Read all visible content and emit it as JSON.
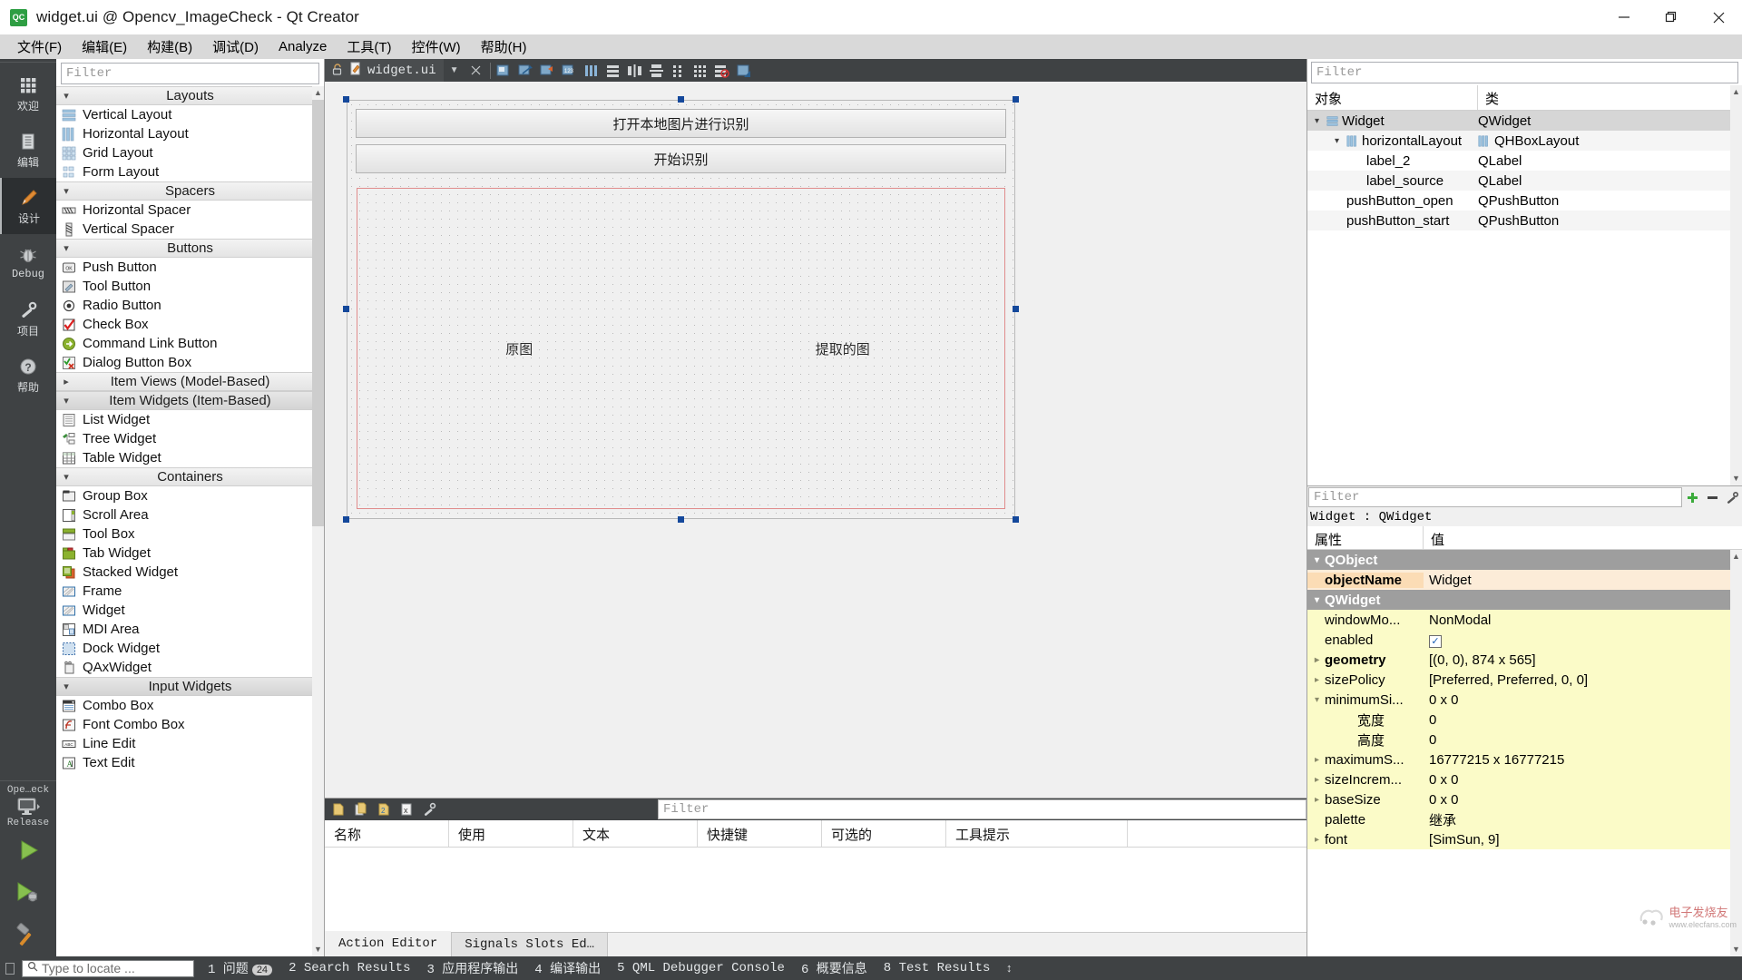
{
  "window": {
    "title": "widget.ui @ Opencv_ImageCheck - Qt Creator",
    "app_badge": "QC",
    "controls": {
      "minimize": "minimize-icon",
      "restore": "restore-icon",
      "close": "close-icon"
    }
  },
  "menubar": [
    "文件(F)",
    "编辑(E)",
    "构建(B)",
    "调试(D)",
    "Analyze",
    "工具(T)",
    "控件(W)",
    "帮助(H)"
  ],
  "modebar": {
    "items": [
      {
        "label": "欢迎",
        "icon": "grid-icon",
        "active": false
      },
      {
        "label": "编辑",
        "icon": "document-icon",
        "active": false
      },
      {
        "label": "设计",
        "icon": "pencil-icon",
        "active": true
      },
      {
        "label": "Debug",
        "icon": "bug-icon",
        "active": false
      },
      {
        "label": "项目",
        "icon": "wrench-icon",
        "active": false
      },
      {
        "label": "帮助",
        "icon": "question-icon",
        "active": false
      }
    ],
    "kit": {
      "project": "Ope…eck",
      "build": "Release",
      "icon": "monitor-icon"
    },
    "run_icon": "run-triangle-icon",
    "debug_icon": "debug-triangle-icon",
    "build_icon": "hammer-icon"
  },
  "widgetbox": {
    "filter_placeholder": "Filter",
    "groups": [
      {
        "title": "Layouts",
        "expanded": true,
        "selected": false,
        "items": [
          {
            "label": "Vertical Layout",
            "icon": "vertical-layout-icon"
          },
          {
            "label": "Horizontal Layout",
            "icon": "horizontal-layout-icon"
          },
          {
            "label": "Grid Layout",
            "icon": "grid-layout-icon"
          },
          {
            "label": "Form Layout",
            "icon": "form-layout-icon"
          }
        ]
      },
      {
        "title": "Spacers",
        "expanded": true,
        "selected": false,
        "items": [
          {
            "label": "Horizontal Spacer",
            "icon": "horizontal-spacer-icon"
          },
          {
            "label": "Vertical Spacer",
            "icon": "vertical-spacer-icon"
          }
        ]
      },
      {
        "title": "Buttons",
        "expanded": true,
        "selected": false,
        "items": [
          {
            "label": "Push Button",
            "icon": "push-button-icon"
          },
          {
            "label": "Tool Button",
            "icon": "tool-button-icon"
          },
          {
            "label": "Radio Button",
            "icon": "radio-button-icon"
          },
          {
            "label": "Check Box",
            "icon": "check-box-icon"
          },
          {
            "label": "Command Link Button",
            "icon": "command-link-icon"
          },
          {
            "label": "Dialog Button Box",
            "icon": "dialog-button-box-icon"
          }
        ]
      },
      {
        "title": "Item Views (Model-Based)",
        "expanded": false,
        "selected": false,
        "items": []
      },
      {
        "title": "Item Widgets (Item-Based)",
        "expanded": true,
        "selected": true,
        "items": [
          {
            "label": "List Widget",
            "icon": "list-widget-icon"
          },
          {
            "label": "Tree Widget",
            "icon": "tree-widget-icon"
          },
          {
            "label": "Table Widget",
            "icon": "table-widget-icon"
          }
        ]
      },
      {
        "title": "Containers",
        "expanded": true,
        "selected": false,
        "items": [
          {
            "label": "Group Box",
            "icon": "group-box-icon"
          },
          {
            "label": "Scroll Area",
            "icon": "scroll-area-icon"
          },
          {
            "label": "Tool Box",
            "icon": "tool-box-icon"
          },
          {
            "label": "Tab Widget",
            "icon": "tab-widget-icon"
          },
          {
            "label": "Stacked Widget",
            "icon": "stacked-widget-icon"
          },
          {
            "label": "Frame",
            "icon": "frame-icon"
          },
          {
            "label": "Widget",
            "icon": "widget-icon"
          },
          {
            "label": "MDI Area",
            "icon": "mdi-area-icon"
          },
          {
            "label": "Dock Widget",
            "icon": "dock-widget-icon"
          },
          {
            "label": "QAxWidget",
            "icon": "qax-widget-icon"
          }
        ]
      },
      {
        "title": "Input Widgets",
        "expanded": true,
        "selected": true,
        "items": [
          {
            "label": "Combo Box",
            "icon": "combo-box-icon"
          },
          {
            "label": "Font Combo Box",
            "icon": "font-combo-box-icon"
          },
          {
            "label": "Line Edit",
            "icon": "line-edit-icon"
          },
          {
            "label": "Text Edit",
            "icon": "text-edit-icon"
          }
        ]
      }
    ]
  },
  "editor": {
    "tab_label": "widget.ui",
    "lock_icon": "unlocked-icon",
    "file_icon": "ui-file-icon",
    "dropdown_icon": "chevron-down-icon",
    "close_icon": "close-icon",
    "toolbar_icons": [
      "edit-widgets-icon",
      "edit-signals-icon",
      "edit-buddies-icon",
      "edit-tab-order-icon",
      "layout-horizontal-icon",
      "layout-vertical-icon",
      "layout-splitter-h-icon",
      "layout-splitter-v-icon",
      "layout-form-icon",
      "layout-grid-icon",
      "break-layout-icon",
      "adjust-size-icon"
    ]
  },
  "form": {
    "buttons": [
      {
        "text": "打开本地图片进行识别",
        "object": "pushButton_open"
      },
      {
        "text": "开始识别",
        "object": "pushButton_start"
      }
    ],
    "labels": [
      {
        "text": "原图",
        "object": "label_2"
      },
      {
        "text": "提取的图",
        "object": "label_source"
      }
    ]
  },
  "object_inspector": {
    "filter_placeholder": "Filter",
    "columns": [
      "对象",
      "类"
    ],
    "rows": [
      {
        "name": "Widget",
        "class": "QWidget",
        "depth": 0,
        "twisty": "expanded",
        "icon": "widget-icon",
        "selected": true
      },
      {
        "name": "horizontalLayout",
        "class": "QHBoxLayout",
        "depth": 1,
        "twisty": "expanded",
        "icon": "hbox-icon",
        "selected": false
      },
      {
        "name": "label_2",
        "class": "QLabel",
        "depth": 2,
        "twisty": "none",
        "icon": "",
        "selected": false
      },
      {
        "name": "label_source",
        "class": "QLabel",
        "depth": 2,
        "twisty": "none",
        "icon": "",
        "selected": false
      },
      {
        "name": "pushButton_open",
        "class": "QPushButton",
        "depth": 1,
        "twisty": "none",
        "icon": "",
        "selected": false
      },
      {
        "name": "pushButton_start",
        "class": "QPushButton",
        "depth": 1,
        "twisty": "none",
        "icon": "",
        "selected": false
      }
    ]
  },
  "property_editor": {
    "filter_placeholder": "Filter",
    "add_icon": "plus-icon",
    "remove_icon": "minus-icon",
    "config_icon": "wrench-icon",
    "object_line": "Widget : QWidget",
    "columns": [
      "属性",
      "值"
    ],
    "rows": [
      {
        "key": "QObject",
        "value": "",
        "type": "group",
        "twisty": "expanded"
      },
      {
        "key": "objectName",
        "value": "Widget",
        "type": "orange",
        "twisty": "none",
        "bold": true
      },
      {
        "key": "QWidget",
        "value": "",
        "type": "group",
        "twisty": "expanded"
      },
      {
        "key": "windowMo...",
        "value": "NonModal",
        "type": "yellow",
        "twisty": "none",
        "bold": false
      },
      {
        "key": "enabled",
        "value": "",
        "type": "yellow",
        "twisty": "none",
        "bold": false,
        "checkbox": true
      },
      {
        "key": "geometry",
        "value": "[(0, 0), 874 x 565]",
        "type": "yellow",
        "twisty": "collapsed",
        "bold": true
      },
      {
        "key": "sizePolicy",
        "value": "[Preferred, Preferred, 0, 0]",
        "type": "yellow",
        "twisty": "collapsed",
        "bold": false
      },
      {
        "key": "minimumSi...",
        "value": "0 x 0",
        "type": "yellow",
        "twisty": "expanded",
        "bold": false
      },
      {
        "key": "宽度",
        "value": "0",
        "type": "yellow",
        "twisty": "none",
        "bold": false,
        "indent": 2
      },
      {
        "key": "高度",
        "value": "0",
        "type": "yellow",
        "twisty": "none",
        "bold": false,
        "indent": 2
      },
      {
        "key": "maximumS...",
        "value": "16777215 x 16777215",
        "type": "yellow",
        "twisty": "collapsed",
        "bold": false
      },
      {
        "key": "sizeIncrem...",
        "value": "0 x 0",
        "type": "yellow",
        "twisty": "collapsed",
        "bold": false
      },
      {
        "key": "baseSize",
        "value": "0 x 0",
        "type": "yellow",
        "twisty": "collapsed",
        "bold": false
      },
      {
        "key": "palette",
        "value": "继承",
        "type": "yellow",
        "twisty": "none",
        "bold": false
      },
      {
        "key": "font",
        "value": "[SimSun, 9]",
        "type": "yellow",
        "twisty": "collapsed",
        "bold": false
      }
    ]
  },
  "action_editor": {
    "filter_placeholder": "Filter",
    "toolbar_icons": [
      "new-action-icon",
      "copy-action-icon",
      "paste-action-icon",
      "delete-action-icon",
      "configure-icon"
    ],
    "columns": [
      "名称",
      "使用",
      "文本",
      "快捷键",
      "可选的",
      "工具提示"
    ],
    "tabs": [
      {
        "label": "Action Editor",
        "selected": true
      },
      {
        "label": "Signals  Slots Ed…",
        "selected": false
      }
    ]
  },
  "statusbar": {
    "locator_placeholder": "Type to locate ...",
    "search_icon": "search-icon",
    "items": [
      {
        "label": "1 问题",
        "badge": "24"
      },
      {
        "label": "2 Search Results",
        "badge": ""
      },
      {
        "label": "3 应用程序输出",
        "badge": ""
      },
      {
        "label": "4 编译输出",
        "badge": ""
      },
      {
        "label": "5 QML Debugger Console",
        "badge": ""
      },
      {
        "label": "6 概要信息",
        "badge": ""
      },
      {
        "label": "8 Test Results",
        "badge": ""
      }
    ],
    "expand_icon": "updown-arrow-icon"
  },
  "watermark": {
    "text": "电子发烧友",
    "sub": "www.elecfans.com"
  },
  "colors": {
    "dark_chrome": "#3f4244",
    "selection_blue": "#14489b",
    "layout_red": "#e08c8c",
    "prop_yellow": "#fbfbc8",
    "prop_orange": "#fcecd8",
    "group_gray": "#9e9e9e"
  }
}
